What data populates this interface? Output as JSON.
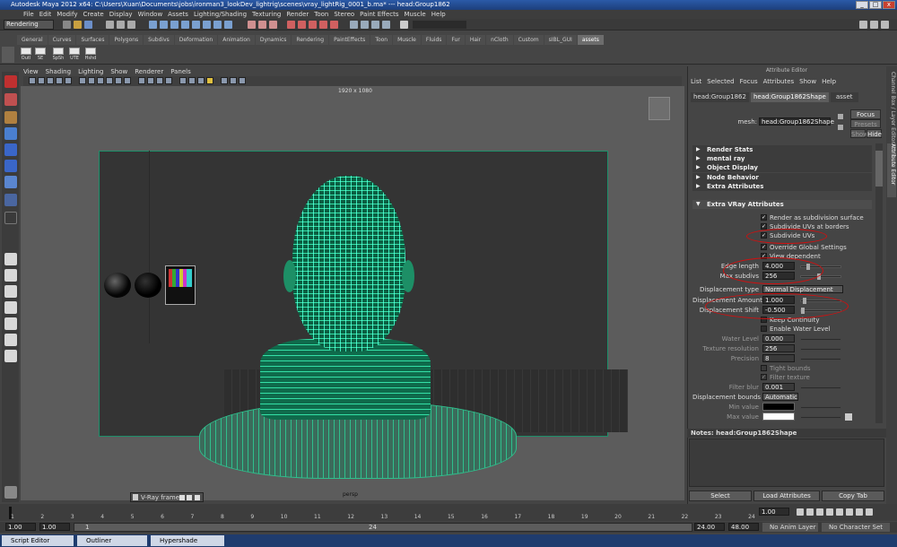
{
  "window": {
    "title": "Autodesk Maya 2012 x64: C:\\Users\\Xuan\\Documents\\jobs\\ironman3_lookDev_lightrig\\scenes\\vray_lightRig_0001_b.ma*    ---    head:Group1862",
    "min": "_",
    "max": "□",
    "close": "x"
  },
  "menu": [
    "File",
    "Edit",
    "Modify",
    "Create",
    "Display",
    "Window",
    "Assets",
    "Lighting/Shading",
    "Texturing",
    "Render",
    "Toon",
    "Stereo",
    "Paint Effects",
    "Muscle",
    "Help"
  ],
  "status": {
    "mode": "Rendering"
  },
  "shelf_tabs": [
    "General",
    "Curves",
    "Surfaces",
    "Polygons",
    "Subdivs",
    "Deformation",
    "Animation",
    "Dynamics",
    "Rendering",
    "PaintEffects",
    "Toon",
    "Muscle",
    "Fluids",
    "Fur",
    "Hair",
    "nCloth",
    "Custom",
    "sIBL_GUI",
    "assets"
  ],
  "shelf_items": [
    "Outl",
    "SE",
    "SpSh",
    "UTE",
    "Hshd"
  ],
  "viewport": {
    "menu": [
      "View",
      "Shading",
      "Lighting",
      "Show",
      "Renderer",
      "Panels"
    ],
    "resolution": "1920 x 1080",
    "camera": "persp",
    "floating": "V-Ray frame..."
  },
  "attr": {
    "title": "Attribute Editor",
    "menu": [
      "List",
      "Selected",
      "Focus",
      "Attributes",
      "Show",
      "Help"
    ],
    "tabs": [
      "head:Group1862",
      "head:Group1862Shape",
      "asset"
    ],
    "mesh_label": "mesh:",
    "mesh_value": "head:Group1862Shape",
    "focus": "Focus",
    "presets": "Presets",
    "show": "Show",
    "hide": "Hide",
    "sections": [
      "Render Stats",
      "mental ray",
      "Object Display",
      "Node Behavior",
      "Extra Attributes"
    ],
    "vray_title": "Extra VRay Attributes",
    "checks": [
      {
        "label": "Render as subdivision surface",
        "checked": "✓"
      },
      {
        "label": "Subdivide UVs at borders",
        "checked": "✓"
      },
      {
        "label": "Subdivide UVs",
        "checked": "✓"
      },
      {
        "label": "Override Global Settings",
        "checked": "✓"
      },
      {
        "label": "View dependent",
        "checked": "✓"
      }
    ],
    "edge_label": "Edge length",
    "edge_value": "4.000",
    "maxsub_label": "Max subdivs",
    "maxsub_value": "256",
    "disptype_label": "Displacement type",
    "disptype_value": "Normal Displacement",
    "dispamt_label": "Displacement Amount",
    "dispamt_value": "1.000",
    "dispshift_label": "Displacement Shift",
    "dispshift_value": "-0.500",
    "keep_label": "Keep Continuity",
    "water_label": "Enable Water Level",
    "dim_rows": [
      {
        "label": "Water Level",
        "value": "0.000"
      },
      {
        "label": "Texture resolution",
        "value": "256"
      },
      {
        "label": "Precision",
        "value": "8"
      }
    ],
    "tight": "Tight bounds",
    "filter_tex": "Filter texture",
    "filter_blur": "Filter blur",
    "filter_blur_value": "0.001",
    "bounds_label": "Displacement bounds",
    "bounds_value": "Automatic",
    "min_label": "Min value",
    "max_label": "Max value",
    "notes": "Notes:  head:Group1862Shape",
    "buttons": [
      "Select",
      "Load Attributes",
      "Copy Tab"
    ],
    "side_tabs": [
      "Channel Box / Layer Editor",
      "Attribute Editor"
    ]
  },
  "timeline": {
    "ticks": [
      "1",
      "2",
      "3",
      "4",
      "5",
      "6",
      "7",
      "8",
      "9",
      "10",
      "11",
      "12",
      "13",
      "14",
      "15",
      "16",
      "17",
      "18",
      "19",
      "20",
      "21",
      "22",
      "23",
      "24"
    ],
    "current": "1.00"
  },
  "range": {
    "start": "1.00",
    "start2": "1.00",
    "frame": "1",
    "end": "24",
    "end2": "24.00",
    "end3": "48.00",
    "anim_layer": "No Anim Layer",
    "char_set": "No Character Set"
  },
  "taskbar": [
    "Script Editor",
    "Outliner",
    "Hypershade"
  ]
}
